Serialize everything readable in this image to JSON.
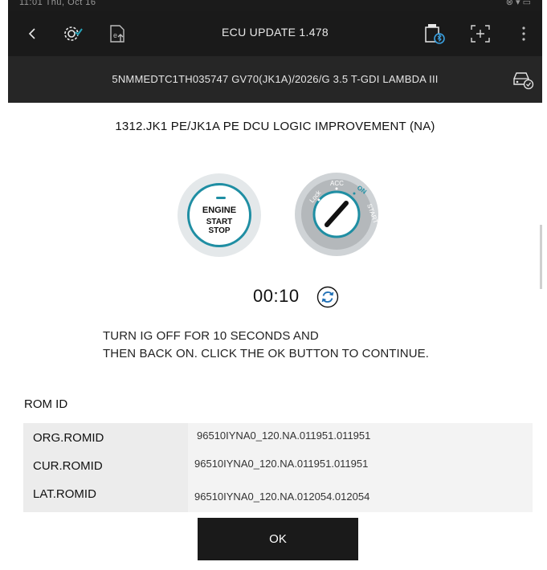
{
  "statusbar": {
    "left_text": "11:01  Thu, Oct 16",
    "right_text": "⊗ ▾ ▭"
  },
  "header": {
    "title": "ECU UPDATE 1.478"
  },
  "vehicle": {
    "vin_info": "5NMMEDTC1TH035747  GV70(JK1A)/2026/G 3.5 T-GDI LAMBDA III"
  },
  "update": {
    "name": "1312.JK1 PE/JK1A PE DCU LOGIC IMPROVEMENT (NA)"
  },
  "engine_button": {
    "line1": "ENGINE",
    "line2": "START",
    "line3": "STOP"
  },
  "ignition": {
    "lock": "Lock",
    "acc": "ACC",
    "on": "ON",
    "start": "START"
  },
  "timer": {
    "value": "00:10"
  },
  "instructions": {
    "line1": "TURN IG OFF FOR 10 SECONDS AND",
    "line2": "THEN BACK ON. CLICK THE OK BUTTON TO CONTINUE."
  },
  "romid": {
    "label": "ROM ID",
    "rows": [
      {
        "key": "ORG.ROMID",
        "value": "96510IYNA0_120.NA.011951.011951"
      },
      {
        "key": "CUR.ROMID",
        "value": "96510IYNA0_120.NA.011951.011951"
      },
      {
        "key": "LAT.ROMID",
        "value": "96510IYNA0_120.NA.012054.012054"
      }
    ]
  },
  "ok_button": {
    "label": "OK"
  },
  "colors": {
    "accent": "#1f8ea3",
    "bar_dark": "#1a1a1a",
    "bar_vin": "#262626"
  }
}
